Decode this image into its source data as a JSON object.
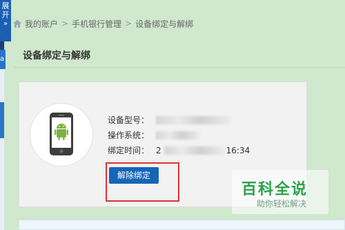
{
  "side_panel": {
    "tab_text_1": "展",
    "tab_text_2": "开",
    "tab_chevron": "»",
    "side_char": "a"
  },
  "breadcrumb": {
    "home_icon": "home-icon",
    "items": [
      "我的账户",
      "手机银行管理",
      "设备绑定与解绑"
    ],
    "separator": ">"
  },
  "page": {
    "title": "设备绑定与解绑"
  },
  "device": {
    "icon": "android-phone-icon",
    "model_label": "设备型号：",
    "system_label": "操作系统：",
    "bind_time_label": "绑定时间：",
    "bind_time_prefix": "2",
    "bind_time_suffix": "16:34",
    "unbind_button": "解除绑定"
  },
  "watermark": {
    "main": "百科全说",
    "sub": "助你轻松解决"
  },
  "colors": {
    "background": "#cfe8ce",
    "button": "#1565b8",
    "highlight": "#e03030",
    "android": "#7cb342"
  }
}
